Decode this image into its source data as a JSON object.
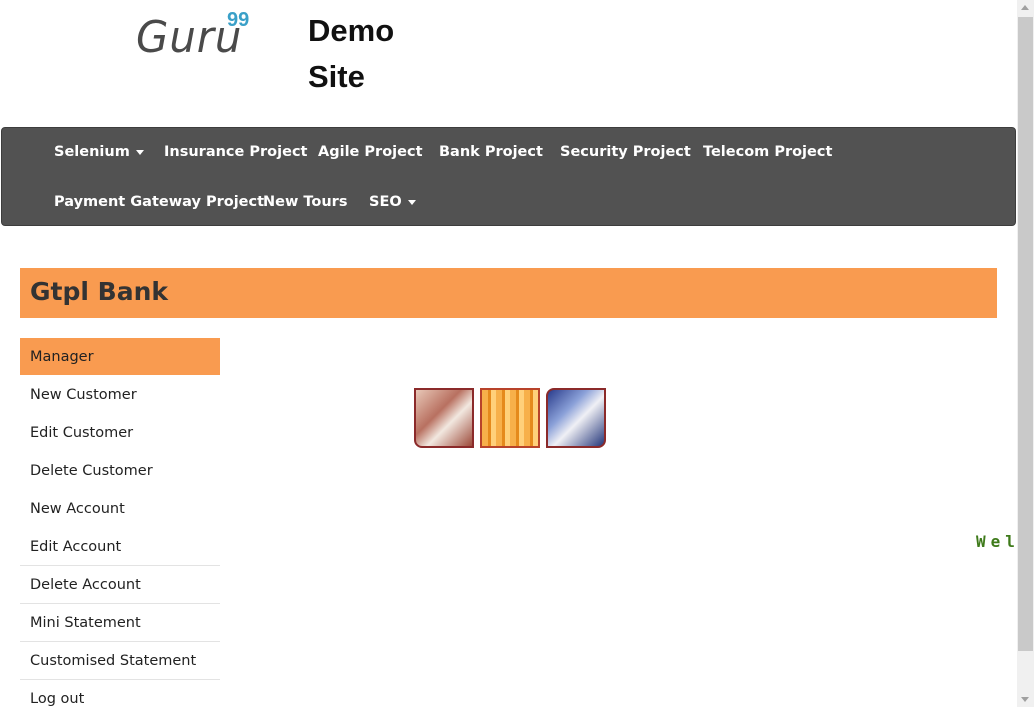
{
  "header": {
    "logo_text": "Guru",
    "logo_sup": "99",
    "site_title": "Demo Site"
  },
  "nav": {
    "items": [
      {
        "label": "Selenium",
        "dropdown": true
      },
      {
        "label": "Insurance Project"
      },
      {
        "label": "Agile Project"
      },
      {
        "label": "Bank Project"
      },
      {
        "label": "Security Project"
      },
      {
        "label": "Telecom Project"
      },
      {
        "label": "Payment Gateway Project"
      },
      {
        "label": "New Tours"
      },
      {
        "label": "SEO",
        "dropdown": true
      }
    ]
  },
  "banner": {
    "title": "Gtpl Bank"
  },
  "menu": {
    "items": [
      {
        "label": "Manager"
      },
      {
        "label": "New Customer"
      },
      {
        "label": "Edit Customer"
      },
      {
        "label": "Delete Customer"
      },
      {
        "label": "New Account"
      },
      {
        "label": "Edit Account"
      },
      {
        "label": "Delete Account"
      },
      {
        "label": "Mini Statement"
      },
      {
        "label": "Customised Statement"
      },
      {
        "label": "Log out"
      }
    ]
  },
  "marquee": {
    "text": "Wel"
  },
  "colors": {
    "accent": "#f99b50",
    "navbar": "#525252",
    "welcome": "#3e7a1a",
    "logo_sup": "#3aa0c8"
  }
}
